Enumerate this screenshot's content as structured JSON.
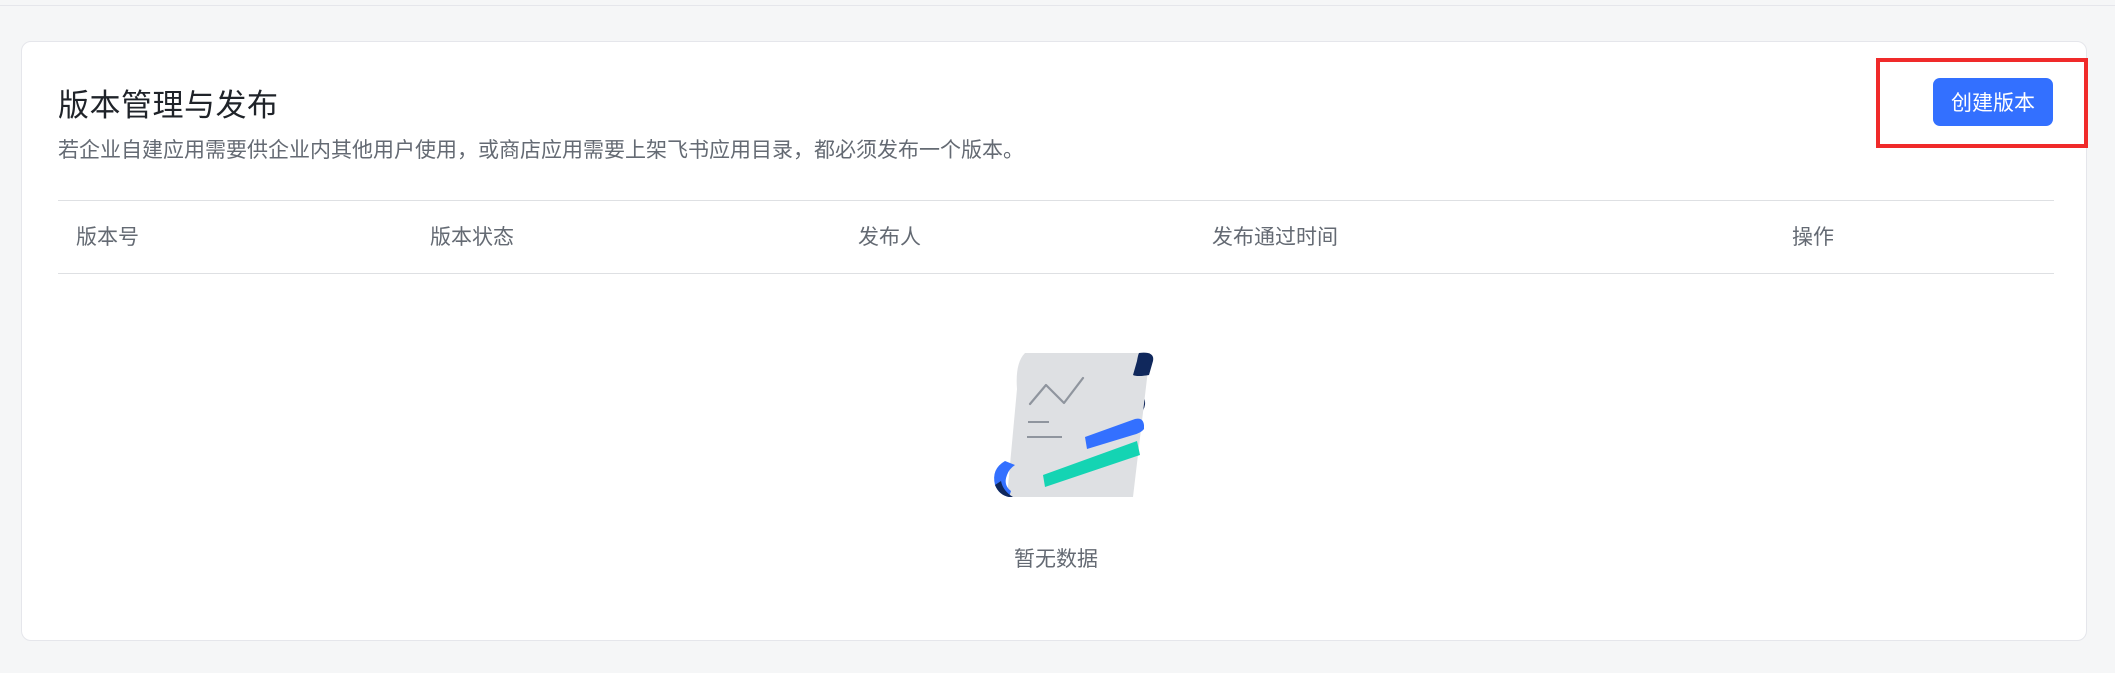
{
  "header": {
    "title": "版本管理与发布",
    "subtitle": "若企业自建应用需要供企业内其他用户使用，或商店应用需要上架飞书应用目录，都必须发布一个版本。",
    "create_button_label": "创建版本"
  },
  "table": {
    "columns": [
      "版本号",
      "版本状态",
      "发布人",
      "发布通过时间",
      "操作"
    ]
  },
  "empty_state": {
    "text": "暂无数据",
    "illustration": "empty-document-icon"
  },
  "colors": {
    "primary": "#3370ff",
    "highlight": "#f02a2a",
    "accent_green": "#14d4b3",
    "navy": "#10285c"
  }
}
